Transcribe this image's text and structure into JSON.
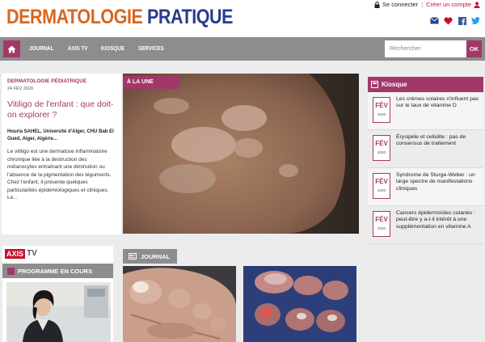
{
  "header": {
    "logo_word1": "DERMATOLOGIE",
    "logo_word2": "PRATIQUE",
    "login_label": "Se connecter",
    "separator": "|",
    "signup_label": "Créer un compte",
    "social_icons": [
      "mail-icon",
      "heart-icon",
      "facebook-icon",
      "twitter-icon"
    ]
  },
  "nav": {
    "items": [
      "JOURNAL",
      "AXIS TV",
      "KIOSQUE",
      "SERVICES"
    ],
    "search_placeholder": "Rechercher",
    "search_button": "OK"
  },
  "featured": {
    "category": "DERMATOLOGIE PÉDIATRIQUE",
    "date": "24 FÉV 2020",
    "title": "Vitiligo de l'enfant : que doit-on explorer ?",
    "author": "Houria SAHEL, Université d'Alger, CHU Bab El Oued, Alger, Algérie...",
    "excerpt": "Le vitiligo est une dermatose inflammatoire chronique liée à la destruction des mélanocytes entraînant une diminution ou l'absence de la pigmentation des téguments. Chez l'enfant, il présente quelques particularités épidémiologiques et cliniques. Le...",
    "label": "À LA UNE"
  },
  "kiosque": {
    "title": "Kiosque",
    "items": [
      {
        "month": "FÉV",
        "year": "2020",
        "title": "Les crèmes solaires n'influent pas sur le taux de vitamine D"
      },
      {
        "month": "FÉV",
        "year": "2020",
        "title": "Érysipèle et cellulite : pas de consensus de traitement"
      },
      {
        "month": "FÉV",
        "year": "2020",
        "title": "Syndrome de Sturge-Weber : un large spectre de manifestations cliniques"
      },
      {
        "month": "FÉV",
        "year": "2020",
        "title": "Cancers épidermoïdes cutanés : peut-être y a-t-il intérêt à une supplémentation en vitamine A"
      }
    ]
  },
  "axis_tv": {
    "logo_part1": "AXIS",
    "logo_part2": "TV",
    "program_label": "PROGRAMME EN COURS"
  },
  "journal": {
    "tab_label": "JOURNAL"
  },
  "colors": {
    "accent": "#a2386a",
    "logo_orange": "#d9661f",
    "logo_blue": "#263d8e",
    "nav_grey": "#8d8d8d",
    "signup_red": "#c8102e"
  }
}
